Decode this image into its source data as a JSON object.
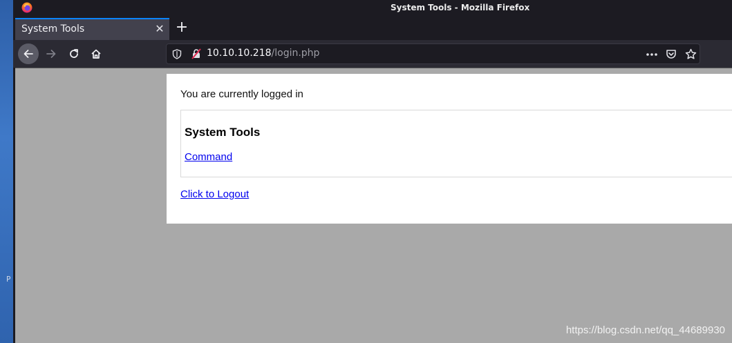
{
  "window": {
    "title": "System Tools - Mozilla Firefox"
  },
  "tabs": [
    {
      "label": "System Tools",
      "active": true
    }
  ],
  "newtab": {
    "symbol": "+"
  },
  "close_symbol": "✕",
  "address": {
    "host": "10.10.10.218",
    "path": "/login.php"
  },
  "page": {
    "status_text": "You are currently logged in",
    "tools_heading": "System Tools",
    "command_link": "Command",
    "logout_link": "Click to Logout"
  },
  "watermark": "https://blog.csdn.net/qq_44689930",
  "desktop_edge_mark": "P",
  "colors": {
    "accent": "#0a84ff",
    "link": "#0000ee",
    "viewport_bg": "#a9a9a9",
    "toolbar_bg": "#2b2a33"
  },
  "icons": [
    "firefox-icon",
    "back-arrow-icon",
    "forward-arrow-icon",
    "reload-icon",
    "home-icon",
    "shield-icon",
    "insecure-lock-icon",
    "more-actions-icon",
    "pocket-icon",
    "bookmark-star-icon",
    "close-icon",
    "plus-icon"
  ]
}
